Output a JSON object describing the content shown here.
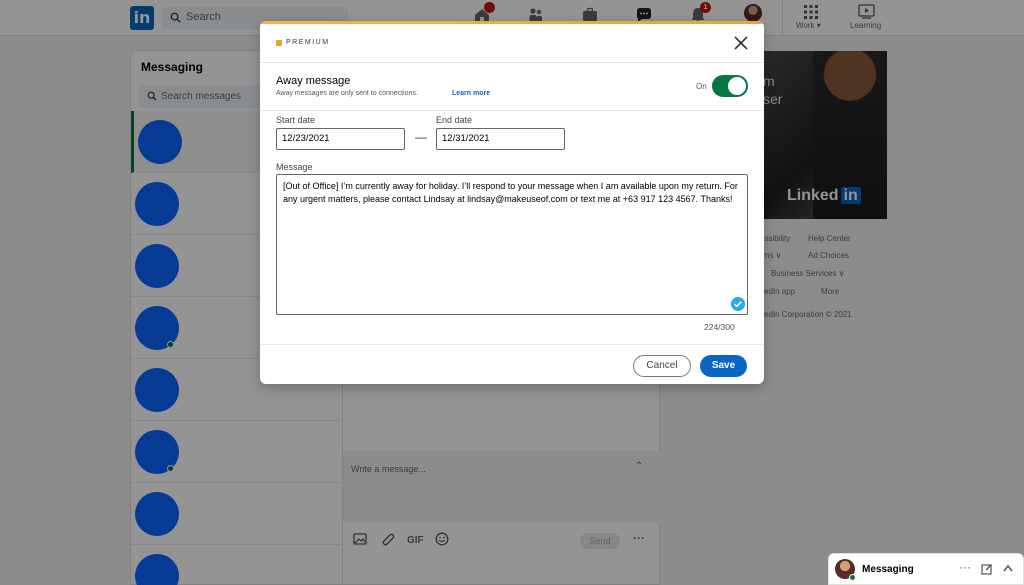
{
  "nav": {
    "logo_text": "in",
    "search_placeholder": "Search",
    "notifications_badge": "1",
    "work_label": "Work ▾",
    "learning_label": "Learning"
  },
  "messaging": {
    "title": "Messaging",
    "search_placeholder": "Search messages",
    "compose_placeholder": "Write a message...",
    "compose_tools": {
      "gif_label": "GIF",
      "send_label": "Send",
      "more_label": "···"
    }
  },
  "rail": {
    "ad_partial_line_1": "m",
    "ad_partial_line_2": "ser",
    "ad_brand": "Linked",
    "ad_brand_in": "in",
    "footer": {
      "accessibility": "essibility",
      "help_center": "Help Center",
      "terms": "rms ∨",
      "ad_choices": "Ad Choices",
      "business_services": "Business Services ∨",
      "app": "kedIn app",
      "more": "More",
      "copyright": "kedIn Corporation © 2021"
    }
  },
  "messaging_bar": {
    "label": "Messaging",
    "more": "···"
  },
  "modal": {
    "premium_label": "PREMIUM",
    "away_title": "Away message",
    "away_subtitle": "Away messages are only sent to connections.",
    "learn_more": "Learn more",
    "toggle_state": "On",
    "start_date_label": "Start date",
    "start_date_value": "12/23/2021",
    "end_date_label": "End date",
    "end_date_value": "12/31/2021",
    "date_separator": "—",
    "message_label": "Message",
    "message_value": "[Out of Office] I’m currently away for holiday. I’ll respond to your message when I am available upon my return. For any urgent matters, please contact Lindsay at lindsay@makeuseof.com or text me at +63 917 123 4567. Thanks!",
    "char_count": "224/300",
    "cancel_label": "Cancel",
    "save_label": "Save"
  },
  "colors": {
    "linkedin_blue": "#0a66c2",
    "toggle_on": "#057642",
    "premium_gold": "#e7a33e",
    "avatar_placeholder": "#0a66ff"
  }
}
